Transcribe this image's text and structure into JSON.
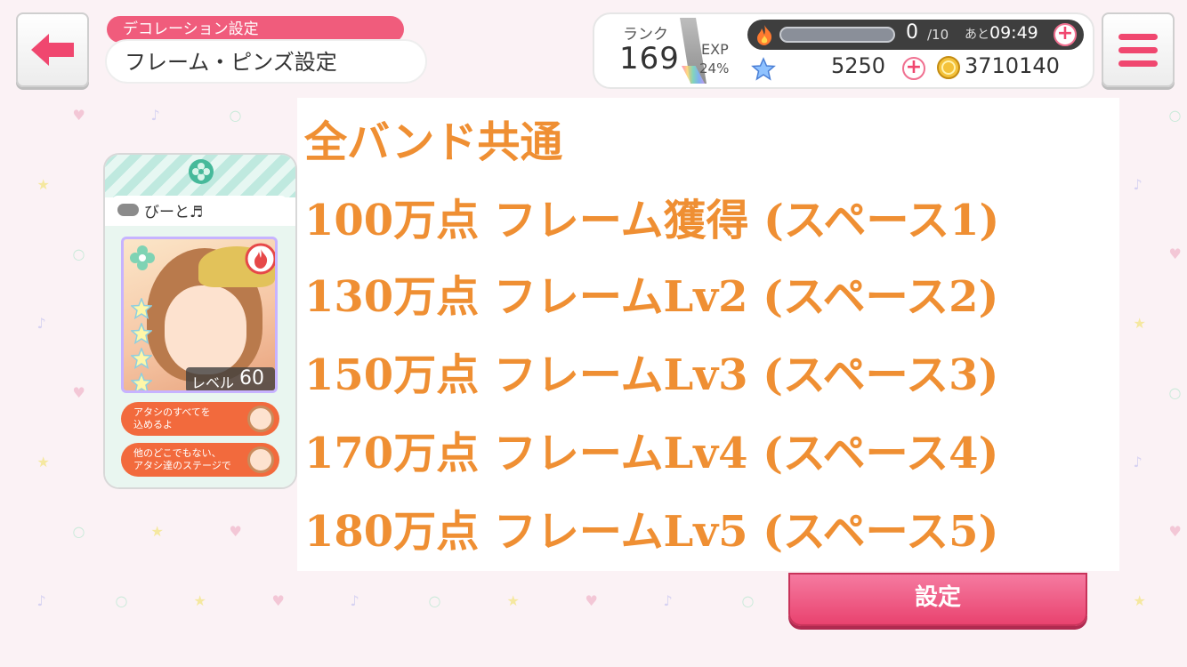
{
  "header": {
    "category": "デコレーション設定",
    "title": "フレーム・ピンズ設定"
  },
  "status": {
    "rank_label": "ランク",
    "rank": "169",
    "exp_label": "EXP",
    "exp_percent": "24%",
    "stamina_current": "0",
    "stamina_max": "/10",
    "timer_prefix": "あと",
    "timer": "09:49",
    "stars": "5250",
    "coins": "3710140"
  },
  "card": {
    "name": "びーと♬",
    "level_label": "レベル",
    "level": "60",
    "star_count": 4,
    "pins": [
      "アタシのすべてを\n込めるよ",
      "他のどこでもない、\nアタシ達のステージで"
    ]
  },
  "overlay": {
    "lines": [
      "全バンド共通",
      "100万点 フレーム獲得 (スペース1)",
      "130万点 フレームLv2 (スペース2)",
      "150万点 フレームLv3 (スペース3)",
      "170万点 フレームLv4 (スペース4)",
      "180万点 フレームLv5 (スペース5)"
    ]
  },
  "actions": {
    "settings_label": "設定"
  },
  "colors": {
    "accent": "#f0476f",
    "overlay_text": "#ef8f33",
    "card_frame": "#c7b3ff"
  }
}
